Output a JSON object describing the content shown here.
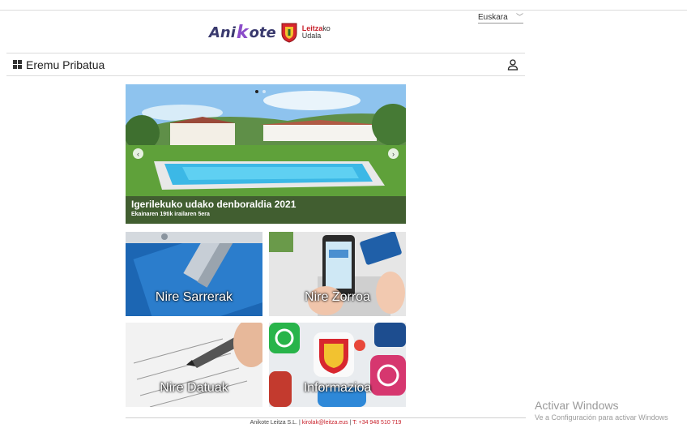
{
  "language": {
    "selected": "Euskara"
  },
  "logos": {
    "brand_left": "Ani",
    "brand_k": "k",
    "brand_right": "ote",
    "udala_line1_red": "Leitza",
    "udala_line1_rest": "ko",
    "udala_line2": "Udala"
  },
  "header": {
    "title": "Eremu Pribatua"
  },
  "carousel": {
    "title": "Igerilekuko udako denboraldia 2021",
    "subtitle": "Ekainaren 19tik irailaren 5era",
    "prev": "‹",
    "next": "›"
  },
  "tiles": [
    {
      "label": "Nire Sarrerak"
    },
    {
      "label": "Nire Zorroa"
    },
    {
      "label": "Nire Datuak"
    },
    {
      "label": "Informazioa"
    }
  ],
  "footer": {
    "company": "Anikote Leitza S.L.",
    "sep1": " | ",
    "email": "kirolak@leitza.eus",
    "sep2": " | ",
    "phone": "T: +34 948 510 719"
  },
  "watermark": {
    "line1": "Activar Windows",
    "line2": "Ve a Configuración para activar Windows"
  }
}
